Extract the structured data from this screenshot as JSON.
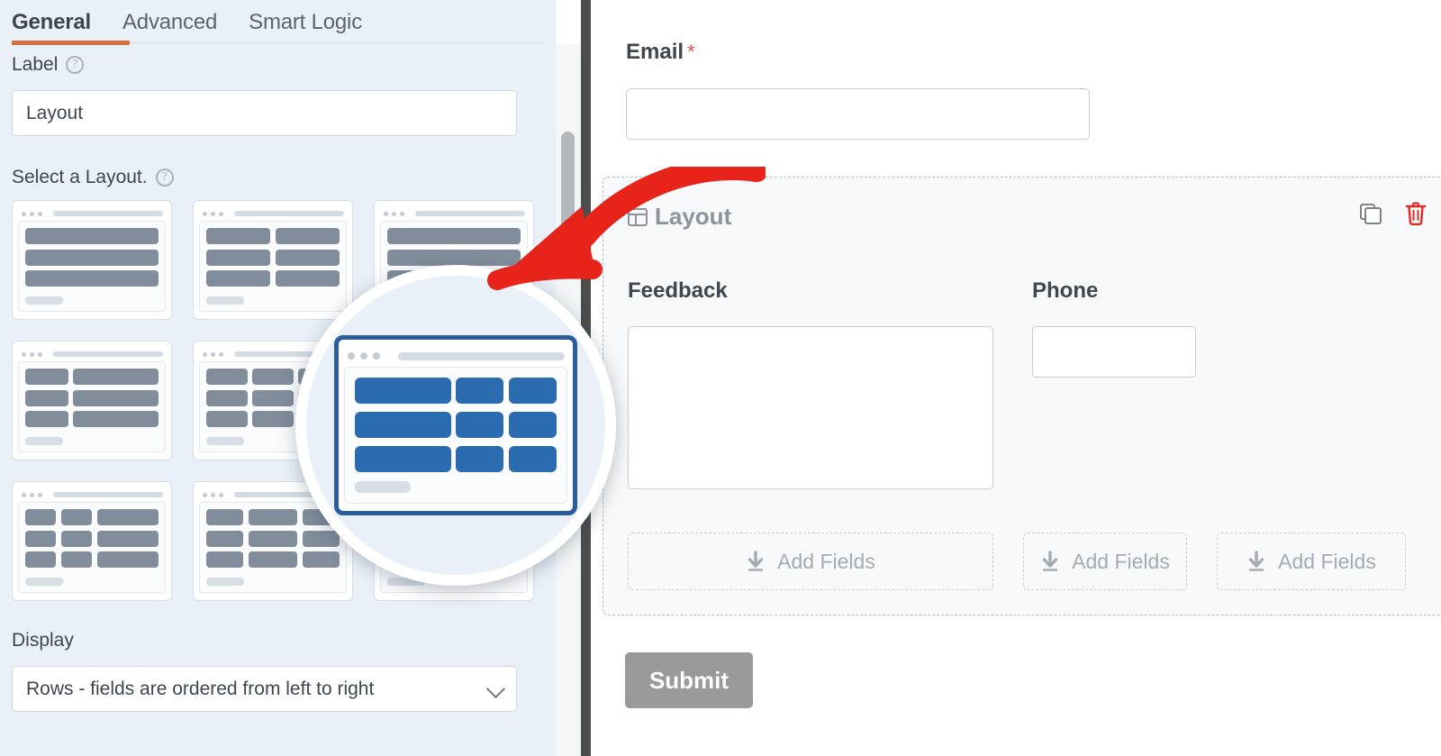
{
  "settings_panel": {
    "tabs": [
      {
        "label": "General",
        "active": true
      },
      {
        "label": "Advanced",
        "active": false
      },
      {
        "label": "Smart Logic",
        "active": false
      }
    ],
    "accent_color": "#d9713f",
    "label_field": {
      "label": "Label",
      "help_icon": "question-circle-icon",
      "value": "Layout",
      "placeholder": ""
    },
    "layout_selector": {
      "label": "Select a Layout.",
      "help_icon": "question-circle-icon",
      "selected_index": 5,
      "selected_color": "#2b6cb0",
      "options": [
        {
          "name": "one-column",
          "columns": [
            [
              100
            ],
            [
              100
            ],
            [
              100
            ]
          ]
        },
        {
          "name": "two-column-50-50",
          "columns": [
            [
              50,
              50
            ],
            [
              50,
              50
            ],
            [
              50,
              50
            ]
          ]
        },
        {
          "name": "two-column-66-33",
          "columns": [
            [
              100
            ],
            [
              100
            ],
            [
              100
            ]
          ]
        },
        {
          "name": "two-column-33-66",
          "columns": [
            [
              33,
              66
            ],
            [
              33,
              66
            ],
            [
              33,
              66
            ]
          ]
        },
        {
          "name": "three-column-33-33-33",
          "columns": [
            [
              33,
              33,
              33
            ],
            [
              33,
              33,
              33
            ],
            [
              33,
              33,
              33
            ]
          ]
        },
        {
          "name": "three-column-50-25-25",
          "columns": [
            [
              50,
              25,
              25
            ],
            [
              50,
              25,
              25
            ],
            [
              50,
              25,
              25
            ]
          ]
        },
        {
          "name": "three-column-25-25-50",
          "columns": [
            [
              25,
              25,
              50
            ],
            [
              25,
              25,
              50
            ],
            [
              25,
              25,
              50
            ]
          ]
        },
        {
          "name": "four-column-25-25-25-25",
          "columns": [
            [
              25,
              33,
              25
            ],
            [
              25,
              33,
              25
            ],
            [
              25,
              33,
              25
            ]
          ]
        },
        {
          "name": "four-column-equal",
          "columns": [
            [
              25,
              25,
              25,
              25
            ],
            [
              25,
              25,
              25,
              25
            ],
            [
              25,
              25,
              25,
              25
            ]
          ]
        }
      ]
    },
    "display_field": {
      "label": "Display",
      "selected": "Rows - fields are ordered from left to right",
      "caret_icon": "chevron-down-icon"
    },
    "scrollbar": {
      "name": "vertical-scrollbar"
    }
  },
  "form_preview": {
    "email_field": {
      "label": "Email",
      "required_marker": "*",
      "required_color": "#d9534f",
      "value": ""
    },
    "layout_block": {
      "title": "Layout",
      "title_icon": "layout-icon",
      "duplicate_icon": "copy-icon",
      "delete_icon": "trash-icon",
      "delete_color": "#e02b27",
      "columns": [
        {
          "label": "Feedback",
          "input_type": "textarea",
          "value": "",
          "add_fields_label": "Add Fields"
        },
        {
          "label": "Phone",
          "input_type": "text",
          "value": "",
          "add_fields_label": "Add Fields"
        },
        {
          "label": "",
          "input_type": "none",
          "value": "",
          "add_fields_label": "Add Fields"
        }
      ],
      "add_fields_icon": "download-arrow-icon"
    },
    "submit_button": {
      "label": "Submit",
      "color": "#9a9a9a"
    }
  },
  "annotation": {
    "magnifier": {
      "name": "magnifier-highlight"
    },
    "arrow": {
      "name": "red-pointer-arrow",
      "color": "#e8231a"
    }
  }
}
